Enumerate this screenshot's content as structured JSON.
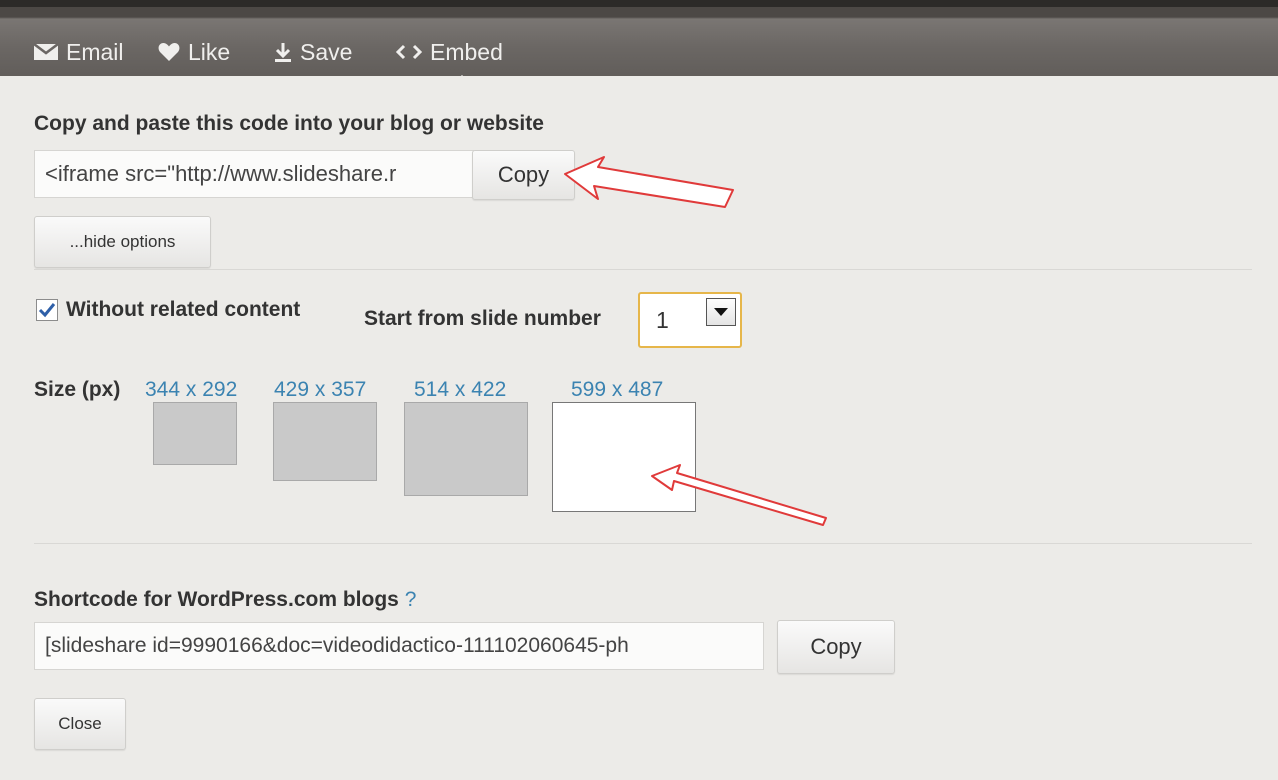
{
  "toolbar": {
    "email_label": "Email",
    "like_label": "Like",
    "save_label": "Save",
    "embed_label": "Embed",
    "icons": [
      "envelope-icon",
      "heart-icon",
      "download-icon",
      "code-icon"
    ]
  },
  "embed": {
    "heading": "Copy and paste this code into your blog or website",
    "code_value": "<iframe src=\"http://www.slideshare.r",
    "copy_label": "Copy",
    "options_label": "...hide options"
  },
  "options": {
    "without_related_label": "Without related content",
    "without_related_checked": true,
    "start_slide_label": "Start from slide number",
    "start_slide_value": "1"
  },
  "sizes": {
    "label": "Size (px)",
    "items": [
      {
        "label": "344 x 292",
        "selected": false
      },
      {
        "label": "429 x 357",
        "selected": false
      },
      {
        "label": "514 x 422",
        "selected": false
      },
      {
        "label": "599 x 487",
        "selected": true
      }
    ]
  },
  "shortcode": {
    "heading": "Shortcode for WordPress.com blogs",
    "help": "?",
    "value": "[slideshare id=9990166&doc=videodidactico-111102060645-ph",
    "copy_label": "Copy"
  },
  "close_label": "Close",
  "colors": {
    "link": "#3b83b1",
    "panel": "#ecebe8",
    "annotation_arrow": "#e03a3a",
    "select_focus": "#e6b64a"
  }
}
